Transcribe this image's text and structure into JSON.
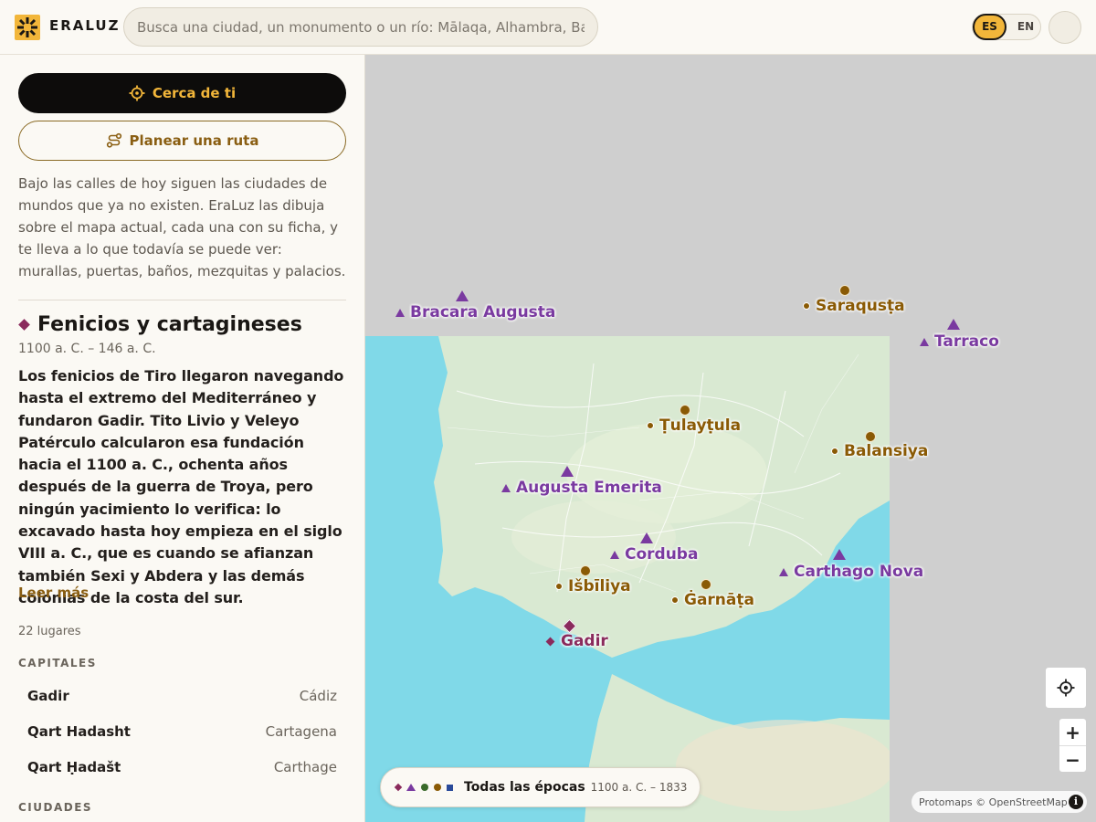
{
  "header": {
    "brand": "ERALUZ",
    "search_placeholder": "Busca una ciudad, un monumento o un río: Mālaqa, Alhambra, Baet",
    "lang_es": "ES",
    "lang_en": "EN"
  },
  "sidebar": {
    "near_button": "Cerca de ti",
    "route_button": "Planear una ruta",
    "intro": "Bajo las calles de hoy siguen las ciudades de mundos que ya no existen. EraLuz las dibuja sobre el mapa actual, cada una con su ficha, y te lleva a lo que todavía se puede ver: murallas, puertas, baños, mezquitas y palacios.",
    "era": {
      "title": "Fenicios y cartagineses",
      "dates": "1100 a. C. – 146 a. C.",
      "description": "Los fenicios de Tiro llegaron navegando hasta el extremo del Mediterráneo y fundaron Gadir. Tito Livio y Veleyo Patérculo calcularon esa fundación hacia el 1100 a. C., ochenta años después de la guerra de Troya, pero ningún yacimiento lo verifica: lo excavado hasta hoy empieza en el siglo VIII a. C., que es cuando se afianzan también Sexi y Abdera y las demás colonias de la costa del sur.",
      "read_more": "Leer más",
      "count": "22 lugares"
    },
    "sections": {
      "capitals_label": "CAPITALES",
      "cities_label": "CIUDADES"
    },
    "capitals": [
      {
        "name": "Gadir",
        "modern": "Cádiz"
      },
      {
        "name": "Qart Hadasht",
        "modern": "Cartagena"
      },
      {
        "name": "Qart Ḥadašt",
        "modern": "Carthage"
      }
    ]
  },
  "map": {
    "places": [
      {
        "name": "Bracara Augusta",
        "kind": "triangle"
      },
      {
        "name": "Saraqusṭa",
        "kind": "dot"
      },
      {
        "name": "Tarraco",
        "kind": "triangle"
      },
      {
        "name": "Ṭulayṭula",
        "kind": "dot"
      },
      {
        "name": "Balansiya",
        "kind": "dot"
      },
      {
        "name": "Augusta Emerita",
        "kind": "triangle"
      },
      {
        "name": "Corduba",
        "kind": "triangle"
      },
      {
        "name": "Carthago Nova",
        "kind": "triangle"
      },
      {
        "name": "Išbīliya",
        "kind": "dot"
      },
      {
        "name": "Ġarnāṭa",
        "kind": "dot"
      },
      {
        "name": "Gadir",
        "kind": "diamond"
      }
    ],
    "zoom_in": "+",
    "zoom_out": "−",
    "attribution": "Protomaps © OpenStreetMap",
    "info_icon": "i"
  },
  "era_pill": {
    "title": "Todas las épocas",
    "range": "1100 a. C. – 1833"
  },
  "colors": {
    "accent": "#f2b63a",
    "roman": "#7a3aa0",
    "andalusi": "#8a5a05",
    "phoenician": "#8a2a5c",
    "sea": "#80d9e8",
    "land": "#d9e9d2",
    "map_bg": "#cfcfcf"
  }
}
